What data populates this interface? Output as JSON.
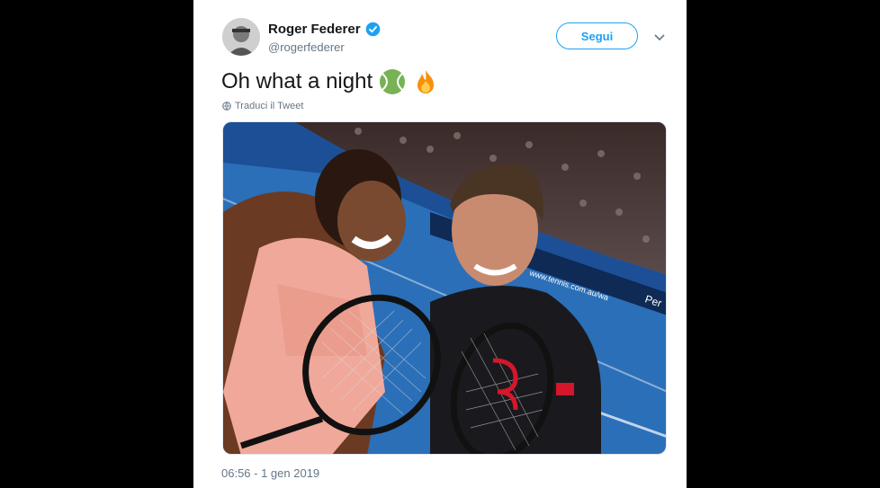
{
  "tweet": {
    "author_name": "Roger Federer",
    "author_handle": "@rogerfederer",
    "verified": true,
    "follow_label": "Segui",
    "text": "Oh what a night",
    "emojis": [
      "tennis-ball-emoji",
      "fire-emoji"
    ],
    "translate_label": "Traduci il Tweet",
    "timestamp": "06:56 - 1 gen 2019"
  },
  "photo": {
    "subject": "selfie-on-tennis-court",
    "visible_texts": [
      "www.tennis.com.au/wa",
      "Per"
    ]
  },
  "colors": {
    "accent": "#1da1f2",
    "text_primary": "#14171a",
    "text_secondary": "#657786",
    "background": "#000000",
    "card": "#ffffff"
  }
}
